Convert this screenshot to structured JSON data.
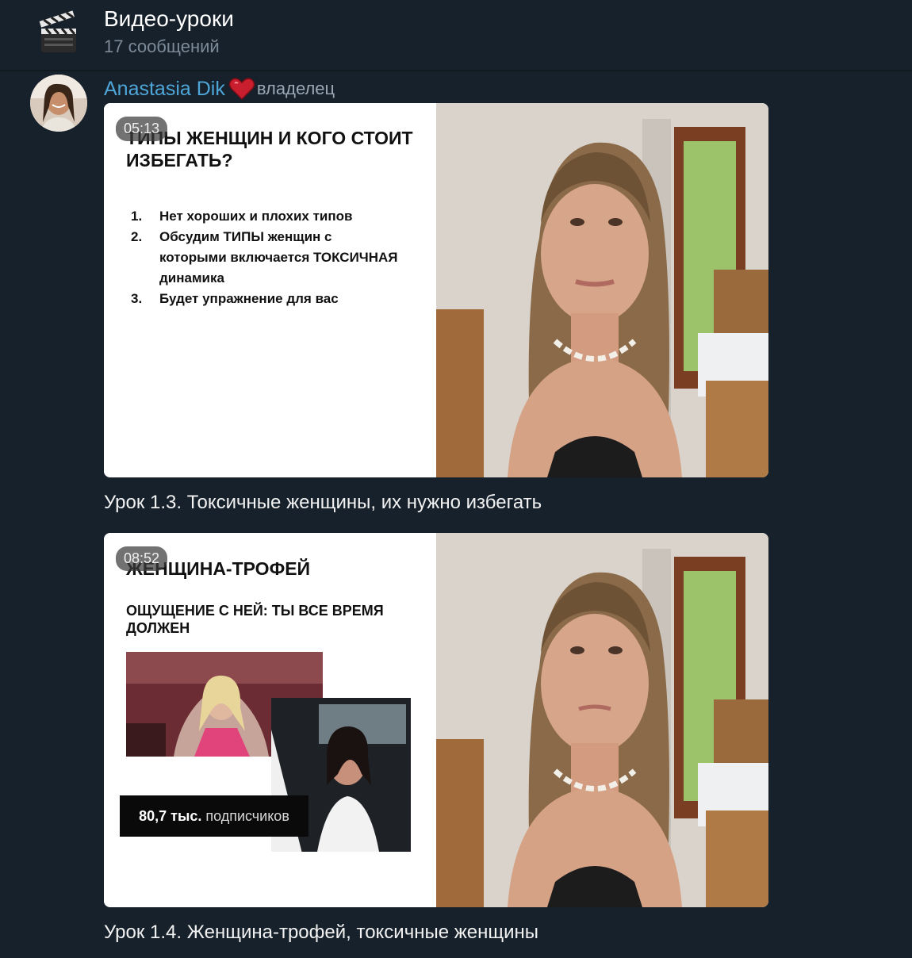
{
  "header": {
    "title": "Видео-уроки",
    "subtitle": "17 сообщений",
    "icon": "clapperboard-icon"
  },
  "post": {
    "author": "Anastasia Dik",
    "badge_icon": "heart-icon",
    "role": "владелец",
    "videos": [
      {
        "duration": "05:13",
        "slide_title": "ТИПЫ ЖЕНЩИН И КОГО СТОИТ ИЗБЕГАТЬ?",
        "list": [
          {
            "num": "1.",
            "text": "Нет хороших и плохих типов"
          },
          {
            "num": "2.",
            "text": "Обсудим ТИПЫ женщин с которыми включается ТОКСИЧНАЯ динамика"
          },
          {
            "num": "3.",
            "text": "Будет упражнение для вас"
          }
        ],
        "caption": "Урок 1.3. Токсичные женщины, их нужно избегать"
      },
      {
        "duration": "08:52",
        "slide_title": "ЖЕНЩИНА-ТРОФЕЙ",
        "slide_subtitle": "ОЩУЩЕНИЕ С НЕЙ: ТЫ ВСЕ ВРЕМЯ ДОЛЖЕН",
        "subs_count": "80,7 тыс.",
        "subs_label": "подписчиков",
        "caption": "Урок 1.4. Женщина-трофей, токсичные женщины"
      }
    ]
  },
  "colors": {
    "background": "#17212b",
    "author": "#4ea6d8",
    "muted": "#7d8b99"
  }
}
